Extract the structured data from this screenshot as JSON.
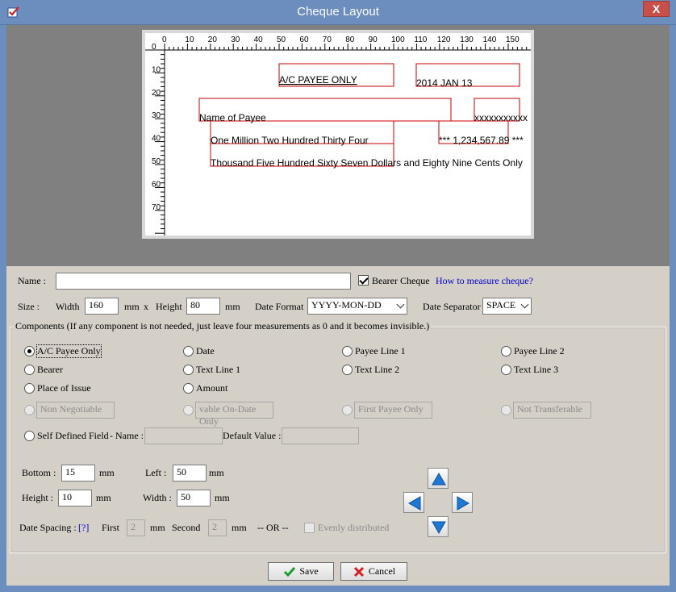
{
  "window": {
    "title": "Cheque Layout",
    "close_label": "X"
  },
  "cheque_preview": {
    "ruler_x": [
      "0",
      "10",
      "20",
      "30",
      "40",
      "50",
      "60",
      "70",
      "80",
      "90",
      "100",
      "110",
      "120",
      "130",
      "140",
      "150"
    ],
    "ruler_y": [
      "0",
      "10",
      "20",
      "30",
      "40",
      "50",
      "60",
      "70"
    ],
    "fields": {
      "ac_payee": "A/C PAYEE ONLY",
      "date": "2014 JAN 13",
      "payee_name": "Name of Payee",
      "payee_mark": "xxxxxxxxxxx",
      "amount_words_1": "One Million Two Hundred Thirty Four",
      "amount_number": "*** 1,234,567.89 ***",
      "amount_words_2": "Thousand Five Hundred Sixty Seven Dollars and Eighty Nine Cents Only"
    },
    "box_color": "#cc0000"
  },
  "form": {
    "name_label": "Name :",
    "name_value": "",
    "bearer_label": "Bearer Cheque",
    "bearer_checked": true,
    "measure_link": "How to measure cheque?",
    "size_label": "Size :",
    "width_label": "Width",
    "width_value": "160",
    "mm1": "mm",
    "x_label": "x",
    "height_label": "Height",
    "height_value": "80",
    "mm2": "mm",
    "date_format_label": "Date Format",
    "date_format_value": "YYYY-MON-DD",
    "date_sep_label": "Date Separator",
    "date_sep_value": "SPACE"
  },
  "components": {
    "title": "Components (If any component is not needed, just leave four measurements as 0 and it becomes invisible.)",
    "radios": [
      {
        "label": "A/C Payee Only",
        "selected": true
      },
      {
        "label": "Date"
      },
      {
        "label": "Payee Line 1"
      },
      {
        "label": "Payee Line 2"
      },
      {
        "label": "Bearer"
      },
      {
        "label": "Text Line 1"
      },
      {
        "label": "Text Line 2"
      },
      {
        "label": "Text Line 3"
      },
      {
        "label": "Place of Issue"
      },
      {
        "label": "Amount"
      }
    ],
    "disabled_fields": [
      "Non Negotiable",
      "vable On-Date Only",
      "First Payee Only",
      "Not Transferable"
    ],
    "self_defined_label": "Self Defined Field",
    "sd_name_label": "- Name :",
    "sd_name_value": "",
    "default_value_label": "Default Value :",
    "default_value": ""
  },
  "measurements": {
    "bottom_label": "Bottom :",
    "bottom_value": "15",
    "left_label": "Left :",
    "left_value": "50",
    "height_label": "Height :",
    "height_value": "10",
    "width_label": "Width :",
    "width_value": "50",
    "mm": "mm"
  },
  "date_spacing": {
    "label": "Date Spacing :",
    "help": "[?]",
    "first_label": "First",
    "first_value": "2",
    "mm": "mm",
    "second_label": "Second",
    "second_value": "2",
    "or_label": "-- OR --",
    "evenly_label": "Evenly distributed"
  },
  "buttons": {
    "save": "Save",
    "cancel": "Cancel"
  }
}
